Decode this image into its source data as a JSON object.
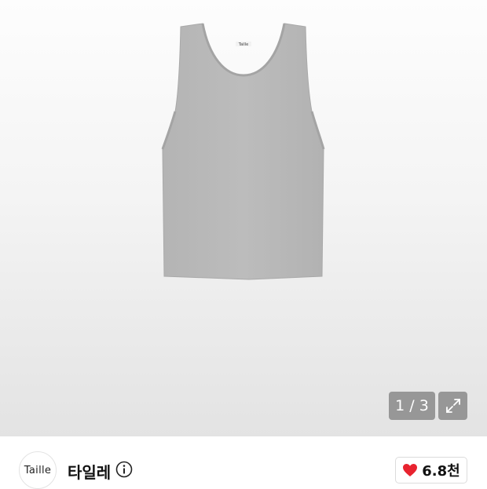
{
  "gallery": {
    "page_indicator": "1 / 3",
    "product_logo_tag": "Taille"
  },
  "brand": {
    "logo_text": "Taille",
    "name": "타일레"
  },
  "like": {
    "count": "6.8천"
  },
  "colors": {
    "heart": "#e8232f",
    "garment": "#b9b9b9"
  },
  "icons": [
    "expand-icon",
    "info-icon",
    "heart-icon"
  ]
}
